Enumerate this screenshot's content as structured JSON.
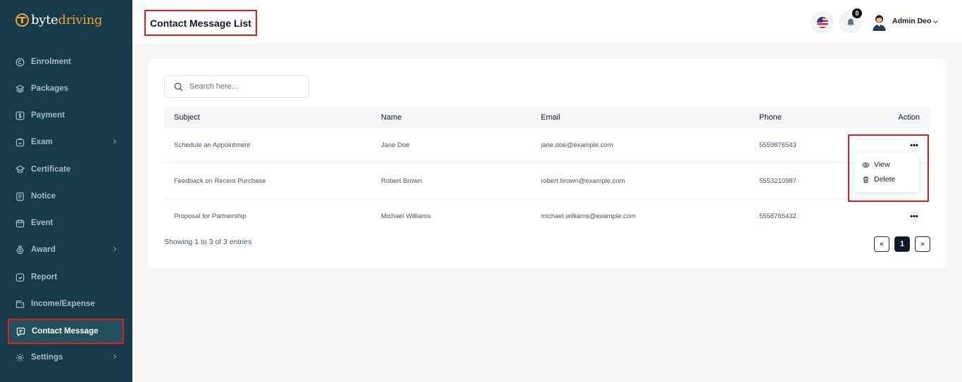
{
  "brand": {
    "logo_part1": "byte",
    "logo_part2": "driving"
  },
  "sidebar": {
    "items": [
      {
        "label": "Enrolment",
        "icon": "enrolment-icon",
        "has_chevron": false
      },
      {
        "label": "Packages",
        "icon": "layers-icon",
        "has_chevron": false
      },
      {
        "label": "Payment",
        "icon": "dollar-icon",
        "has_chevron": false
      },
      {
        "label": "Exam",
        "icon": "exam-icon",
        "has_chevron": true
      },
      {
        "label": "Certificate",
        "icon": "certificate-icon",
        "has_chevron": false
      },
      {
        "label": "Notice",
        "icon": "notice-icon",
        "has_chevron": false
      },
      {
        "label": "Event",
        "icon": "calendar-icon",
        "has_chevron": false
      },
      {
        "label": "Award",
        "icon": "award-icon",
        "has_chevron": true
      },
      {
        "label": "Report",
        "icon": "report-icon",
        "has_chevron": false
      },
      {
        "label": "Income/Expense",
        "icon": "wallet-icon",
        "has_chevron": false
      },
      {
        "label": "Contact Message",
        "icon": "message-icon",
        "has_chevron": false,
        "active": true
      },
      {
        "label": "Settings",
        "icon": "gear-icon",
        "has_chevron": true
      }
    ]
  },
  "header": {
    "title": "Contact Message List",
    "notification_count": "0",
    "user_name": "Admin Deo"
  },
  "search": {
    "placeholder": "Search here..."
  },
  "table": {
    "columns": [
      "Subject",
      "Name",
      "Email",
      "Phone",
      "Action"
    ],
    "rows": [
      {
        "subject": "Schedule an Appointment",
        "name": "Jane Doe",
        "email": "jane.doe@example.com",
        "phone": "5559876543"
      },
      {
        "subject": "Feedback on Recent Purchase",
        "name": "Robert Brown",
        "email": "robert.brown@example.com",
        "phone": "5553210987"
      },
      {
        "subject": "Proposal for Partnership",
        "name": "Michael Williams",
        "email": "michael.williams@example.com",
        "phone": "5558765432"
      }
    ]
  },
  "footer": {
    "entries_text": "Showing 1 to 3 of 3 entries",
    "prev": "«",
    "page": "1",
    "next": "»"
  },
  "action_menu": {
    "view": "View",
    "delete": "Delete"
  },
  "colors": {
    "sidebar_bg": "#173b4a",
    "accent": "#f0a030",
    "highlight": "#e01c1c"
  }
}
